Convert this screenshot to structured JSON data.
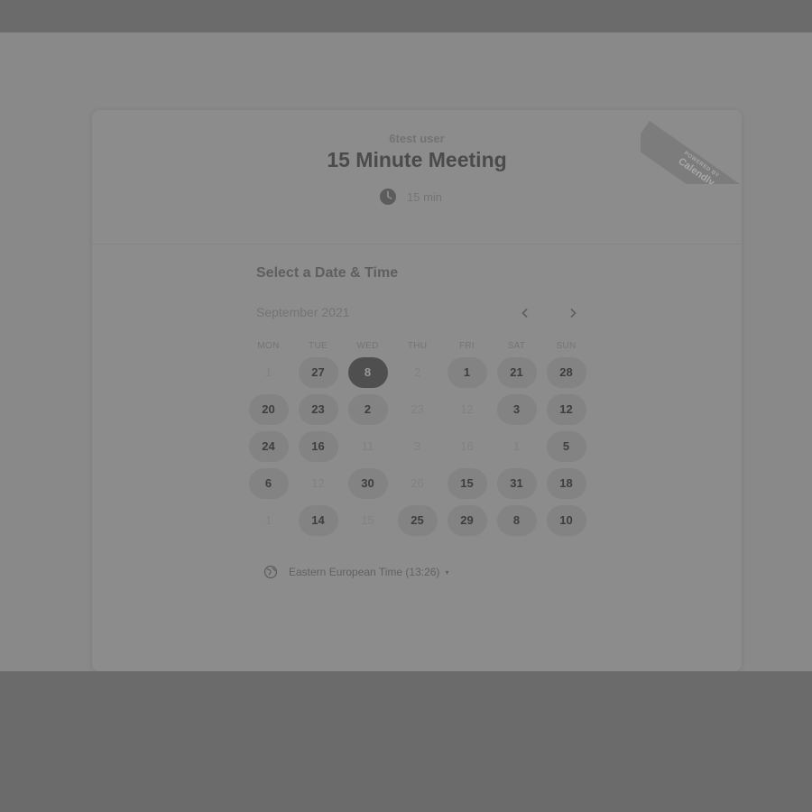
{
  "colors": {
    "page_bg": "#898989",
    "outer_bg": "#6b6b6b",
    "selected_day": "#4f4f4f",
    "available_day": "#838383"
  },
  "branding": {
    "ribbon_small": "POWERED BY",
    "ribbon_brand": "Calendly"
  },
  "event": {
    "host": "6test user",
    "title": "15 Minute Meeting",
    "duration": "15 min",
    "duration_icon": "clock-icon"
  },
  "scheduler": {
    "section_title": "Select a Date & Time",
    "month": "September 2021",
    "prev_icon": "chevron-left-icon",
    "next_icon": "chevron-right-icon",
    "weekdays": [
      "MON",
      "TUE",
      "WED",
      "THU",
      "FRI",
      "SAT",
      "SUN"
    ],
    "days": [
      {
        "label": "1",
        "state": "disabled"
      },
      {
        "label": "27",
        "state": "available"
      },
      {
        "label": "8",
        "state": "selected"
      },
      {
        "label": "2",
        "state": "disabled"
      },
      {
        "label": "1",
        "state": "available"
      },
      {
        "label": "21",
        "state": "available"
      },
      {
        "label": "28",
        "state": "available"
      },
      {
        "label": "20",
        "state": "available"
      },
      {
        "label": "23",
        "state": "available"
      },
      {
        "label": "2",
        "state": "available"
      },
      {
        "label": "23",
        "state": "disabled"
      },
      {
        "label": "12",
        "state": "disabled"
      },
      {
        "label": "3",
        "state": "available"
      },
      {
        "label": "12",
        "state": "available"
      },
      {
        "label": "24",
        "state": "available"
      },
      {
        "label": "16",
        "state": "available"
      },
      {
        "label": "11",
        "state": "disabled"
      },
      {
        "label": "3",
        "state": "disabled"
      },
      {
        "label": "16",
        "state": "disabled"
      },
      {
        "label": "1",
        "state": "disabled"
      },
      {
        "label": "5",
        "state": "available"
      },
      {
        "label": "6",
        "state": "available"
      },
      {
        "label": "12",
        "state": "disabled"
      },
      {
        "label": "30",
        "state": "available"
      },
      {
        "label": "26",
        "state": "disabled"
      },
      {
        "label": "15",
        "state": "available"
      },
      {
        "label": "31",
        "state": "available"
      },
      {
        "label": "18",
        "state": "available"
      },
      {
        "label": "1",
        "state": "disabled"
      },
      {
        "label": "14",
        "state": "available"
      },
      {
        "label": "15",
        "state": "disabled"
      },
      {
        "label": "25",
        "state": "available"
      },
      {
        "label": "29",
        "state": "available"
      },
      {
        "label": "8",
        "state": "available"
      },
      {
        "label": "10",
        "state": "available"
      }
    ],
    "timezone": "Eastern European Time (13:26)",
    "timezone_icon": "globe-icon",
    "timezone_caret": "▾"
  }
}
